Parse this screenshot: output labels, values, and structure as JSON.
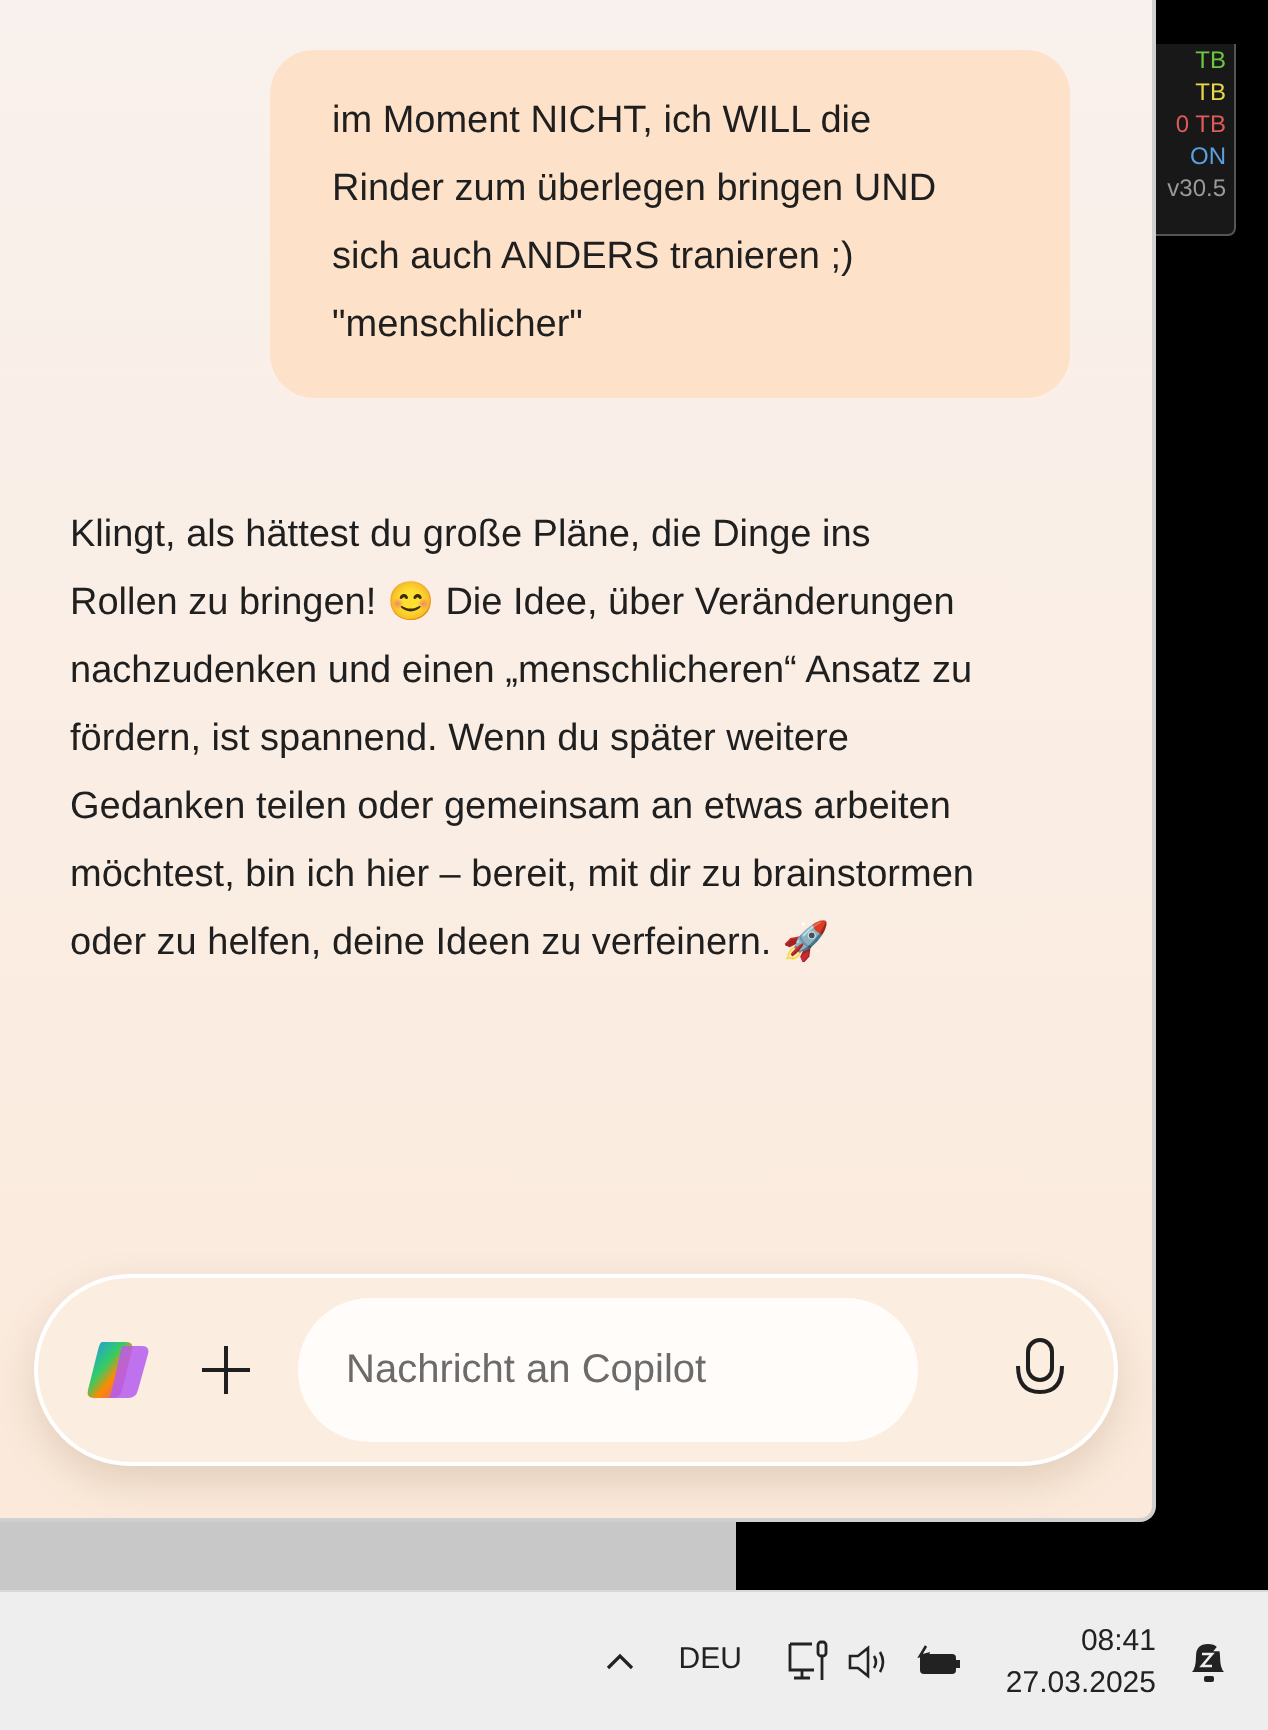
{
  "user_message": {
    "text": "im Moment NICHT, ich WILL die Rinder zum überlegen bringen UND sich auch ANDERS tranieren ;) \"menschlicher\""
  },
  "assistant_message": {
    "text": "Klingt, als hättest du große Pläne, die Dinge ins Rollen zu bringen! 😊 Die Idee, über Veränderungen nachzudenken und einen „menschlicheren“ Ansatz zu fördern, ist spannend. Wenn du später weitere Gedanken teilen oder gemeinsam an etwas arbeiten möchtest, bin ich hier – bereit, mit dir zu brainstormen oder zu helfen, deine Ideen zu verfeinern. 🚀"
  },
  "composer": {
    "placeholder": "Nachricht an Copilot"
  },
  "overlay_widget": {
    "lines": [
      {
        "text": "TB",
        "color": "#6cc644"
      },
      {
        "text": "TB",
        "color": "#e6d84a"
      },
      {
        "text": "0 TB",
        "color": "#e05a5a"
      },
      {
        "text": "ON",
        "color": "#5aa0e0"
      },
      {
        "text": "v30.5",
        "color": "#9a9a9a"
      }
    ]
  },
  "taskbar": {
    "language": "DEU",
    "time": "08:41",
    "date": "27.03.2025"
  }
}
